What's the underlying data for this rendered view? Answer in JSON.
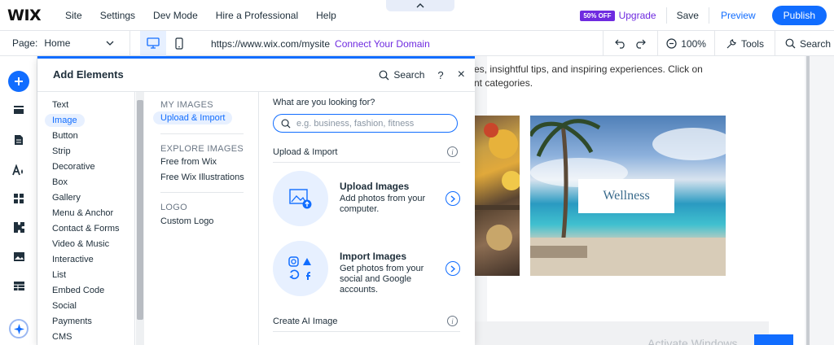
{
  "app": {
    "logo": "WIX",
    "nav": [
      "Site",
      "Settings",
      "Dev Mode",
      "Hire a Professional",
      "Help"
    ],
    "badge": "50% OFF",
    "upgrade": "Upgrade",
    "save": "Save",
    "preview": "Preview",
    "publish": "Publish"
  },
  "toolbar": {
    "page_label": "Page:",
    "page_value": "Home",
    "url": "https://www.wix.com/mysite",
    "connect": "Connect Your Domain",
    "zoom": "100%",
    "tools": "Tools",
    "search": "Search"
  },
  "panel": {
    "title": "Add Elements",
    "search": "Search",
    "help": "?",
    "close": "×",
    "categories": [
      "Text",
      "Image",
      "Button",
      "Strip",
      "Decorative",
      "Box",
      "Gallery",
      "Menu & Anchor",
      "Contact & Forms",
      "Video & Music",
      "Interactive",
      "List",
      "Embed Code",
      "Social",
      "Payments",
      "CMS"
    ],
    "selected_category": "Image",
    "sub": {
      "my_images": "MY IMAGES",
      "upload_import": "Upload & Import",
      "explore_images": "EXPLORE IMAGES",
      "free_wix": "Free from Wix",
      "free_illustrations": "Free Wix Illustrations",
      "logo": "LOGO",
      "custom_logo": "Custom Logo"
    },
    "content": {
      "question": "What are you looking for?",
      "placeholder": "e.g. business, fashion, fitness",
      "section_upload": "Upload & Import",
      "upload_title": "Upload Images",
      "upload_desc": "Add photos from your computer.",
      "import_title": "Import Images",
      "import_desc": "Get photos from your social and Google accounts.",
      "section_ai": "Create AI Image"
    }
  },
  "canvas": {
    "text_line1": "es, insightful tips, and inspiring experiences. Click on",
    "text_line2": "nt categories.",
    "image_caption": "Wellness",
    "watermark": "Activate Windows"
  },
  "colors": {
    "accent": "#116dff",
    "purple": "#6f2be0"
  }
}
